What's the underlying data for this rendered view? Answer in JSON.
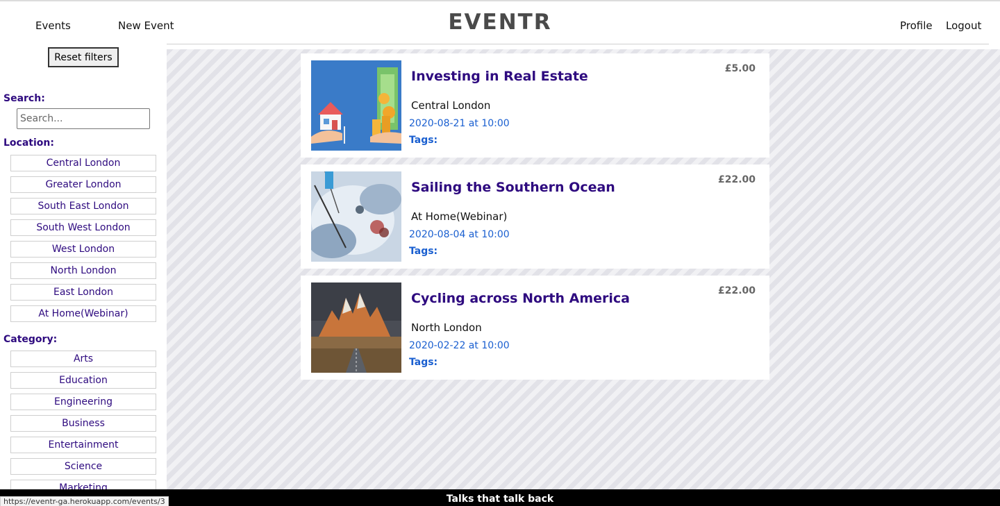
{
  "nav": {
    "brand": "EVENTR",
    "events": "Events",
    "new_event": "New Event",
    "profile": "Profile",
    "logout": "Logout"
  },
  "sidebar": {
    "reset_label": "Reset filters",
    "search_heading": "Search:",
    "search_placeholder": "Search...",
    "location_heading": "Location:",
    "locations": [
      "Central London",
      "Greater London",
      "South East London",
      "South West London",
      "West London",
      "North London",
      "East London",
      "At Home(Webinar)"
    ],
    "category_heading": "Category:",
    "categories": [
      "Arts",
      "Education",
      "Engineering",
      "Business",
      "Entertainment",
      "Science",
      "Marketing"
    ]
  },
  "events": [
    {
      "title": "Investing in Real Estate",
      "location": "Central London",
      "date": "2020-08-21 at 10:00",
      "tags": "Tags:",
      "price": "£5.00",
      "image": "real-estate-image"
    },
    {
      "title": "Sailing the Southern Ocean",
      "location": "At Home(Webinar)",
      "date": "2020-08-04 at 10:00",
      "tags": "Tags:",
      "price": "£22.00",
      "image": "sailing-image"
    },
    {
      "title": "Cycling across North America",
      "location": "North London",
      "date": "2020-02-22 at 10:00",
      "tags": "Tags:",
      "price": "£22.00",
      "image": "mountain-road-image"
    }
  ],
  "footer": {
    "tagline": "Talks that talk back"
  },
  "status_bar": {
    "url": "https://eventr-ga.herokuapp.com/events/3"
  },
  "colors": {
    "accent": "#2e0a7f",
    "date": "#1a5fd0",
    "footer": "#000000"
  }
}
